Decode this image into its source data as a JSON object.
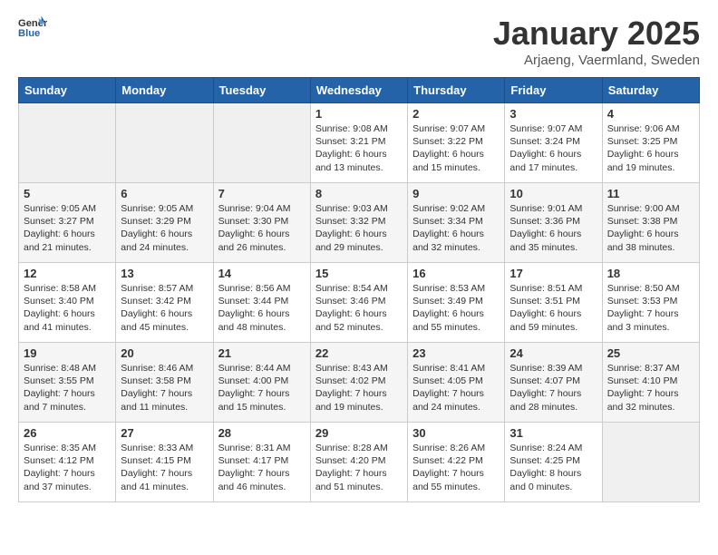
{
  "logo": {
    "text_general": "General",
    "text_blue": "Blue"
  },
  "title": "January 2025",
  "subtitle": "Arjaeng, Vaermland, Sweden",
  "headers": [
    "Sunday",
    "Monday",
    "Tuesday",
    "Wednesday",
    "Thursday",
    "Friday",
    "Saturday"
  ],
  "weeks": [
    [
      {
        "day": "",
        "sunrise": "",
        "sunset": "",
        "daylight": ""
      },
      {
        "day": "",
        "sunrise": "",
        "sunset": "",
        "daylight": ""
      },
      {
        "day": "",
        "sunrise": "",
        "sunset": "",
        "daylight": ""
      },
      {
        "day": "1",
        "sunrise": "Sunrise: 9:08 AM",
        "sunset": "Sunset: 3:21 PM",
        "daylight": "Daylight: 6 hours and 13 minutes."
      },
      {
        "day": "2",
        "sunrise": "Sunrise: 9:07 AM",
        "sunset": "Sunset: 3:22 PM",
        "daylight": "Daylight: 6 hours and 15 minutes."
      },
      {
        "day": "3",
        "sunrise": "Sunrise: 9:07 AM",
        "sunset": "Sunset: 3:24 PM",
        "daylight": "Daylight: 6 hours and 17 minutes."
      },
      {
        "day": "4",
        "sunrise": "Sunrise: 9:06 AM",
        "sunset": "Sunset: 3:25 PM",
        "daylight": "Daylight: 6 hours and 19 minutes."
      }
    ],
    [
      {
        "day": "5",
        "sunrise": "Sunrise: 9:05 AM",
        "sunset": "Sunset: 3:27 PM",
        "daylight": "Daylight: 6 hours and 21 minutes."
      },
      {
        "day": "6",
        "sunrise": "Sunrise: 9:05 AM",
        "sunset": "Sunset: 3:29 PM",
        "daylight": "Daylight: 6 hours and 24 minutes."
      },
      {
        "day": "7",
        "sunrise": "Sunrise: 9:04 AM",
        "sunset": "Sunset: 3:30 PM",
        "daylight": "Daylight: 6 hours and 26 minutes."
      },
      {
        "day": "8",
        "sunrise": "Sunrise: 9:03 AM",
        "sunset": "Sunset: 3:32 PM",
        "daylight": "Daylight: 6 hours and 29 minutes."
      },
      {
        "day": "9",
        "sunrise": "Sunrise: 9:02 AM",
        "sunset": "Sunset: 3:34 PM",
        "daylight": "Daylight: 6 hours and 32 minutes."
      },
      {
        "day": "10",
        "sunrise": "Sunrise: 9:01 AM",
        "sunset": "Sunset: 3:36 PM",
        "daylight": "Daylight: 6 hours and 35 minutes."
      },
      {
        "day": "11",
        "sunrise": "Sunrise: 9:00 AM",
        "sunset": "Sunset: 3:38 PM",
        "daylight": "Daylight: 6 hours and 38 minutes."
      }
    ],
    [
      {
        "day": "12",
        "sunrise": "Sunrise: 8:58 AM",
        "sunset": "Sunset: 3:40 PM",
        "daylight": "Daylight: 6 hours and 41 minutes."
      },
      {
        "day": "13",
        "sunrise": "Sunrise: 8:57 AM",
        "sunset": "Sunset: 3:42 PM",
        "daylight": "Daylight: 6 hours and 45 minutes."
      },
      {
        "day": "14",
        "sunrise": "Sunrise: 8:56 AM",
        "sunset": "Sunset: 3:44 PM",
        "daylight": "Daylight: 6 hours and 48 minutes."
      },
      {
        "day": "15",
        "sunrise": "Sunrise: 8:54 AM",
        "sunset": "Sunset: 3:46 PM",
        "daylight": "Daylight: 6 hours and 52 minutes."
      },
      {
        "day": "16",
        "sunrise": "Sunrise: 8:53 AM",
        "sunset": "Sunset: 3:49 PM",
        "daylight": "Daylight: 6 hours and 55 minutes."
      },
      {
        "day": "17",
        "sunrise": "Sunrise: 8:51 AM",
        "sunset": "Sunset: 3:51 PM",
        "daylight": "Daylight: 6 hours and 59 minutes."
      },
      {
        "day": "18",
        "sunrise": "Sunrise: 8:50 AM",
        "sunset": "Sunset: 3:53 PM",
        "daylight": "Daylight: 7 hours and 3 minutes."
      }
    ],
    [
      {
        "day": "19",
        "sunrise": "Sunrise: 8:48 AM",
        "sunset": "Sunset: 3:55 PM",
        "daylight": "Daylight: 7 hours and 7 minutes."
      },
      {
        "day": "20",
        "sunrise": "Sunrise: 8:46 AM",
        "sunset": "Sunset: 3:58 PM",
        "daylight": "Daylight: 7 hours and 11 minutes."
      },
      {
        "day": "21",
        "sunrise": "Sunrise: 8:44 AM",
        "sunset": "Sunset: 4:00 PM",
        "daylight": "Daylight: 7 hours and 15 minutes."
      },
      {
        "day": "22",
        "sunrise": "Sunrise: 8:43 AM",
        "sunset": "Sunset: 4:02 PM",
        "daylight": "Daylight: 7 hours and 19 minutes."
      },
      {
        "day": "23",
        "sunrise": "Sunrise: 8:41 AM",
        "sunset": "Sunset: 4:05 PM",
        "daylight": "Daylight: 7 hours and 24 minutes."
      },
      {
        "day": "24",
        "sunrise": "Sunrise: 8:39 AM",
        "sunset": "Sunset: 4:07 PM",
        "daylight": "Daylight: 7 hours and 28 minutes."
      },
      {
        "day": "25",
        "sunrise": "Sunrise: 8:37 AM",
        "sunset": "Sunset: 4:10 PM",
        "daylight": "Daylight: 7 hours and 32 minutes."
      }
    ],
    [
      {
        "day": "26",
        "sunrise": "Sunrise: 8:35 AM",
        "sunset": "Sunset: 4:12 PM",
        "daylight": "Daylight: 7 hours and 37 minutes."
      },
      {
        "day": "27",
        "sunrise": "Sunrise: 8:33 AM",
        "sunset": "Sunset: 4:15 PM",
        "daylight": "Daylight: 7 hours and 41 minutes."
      },
      {
        "day": "28",
        "sunrise": "Sunrise: 8:31 AM",
        "sunset": "Sunset: 4:17 PM",
        "daylight": "Daylight: 7 hours and 46 minutes."
      },
      {
        "day": "29",
        "sunrise": "Sunrise: 8:28 AM",
        "sunset": "Sunset: 4:20 PM",
        "daylight": "Daylight: 7 hours and 51 minutes."
      },
      {
        "day": "30",
        "sunrise": "Sunrise: 8:26 AM",
        "sunset": "Sunset: 4:22 PM",
        "daylight": "Daylight: 7 hours and 55 minutes."
      },
      {
        "day": "31",
        "sunrise": "Sunrise: 8:24 AM",
        "sunset": "Sunset: 4:25 PM",
        "daylight": "Daylight: 8 hours and 0 minutes."
      },
      {
        "day": "",
        "sunrise": "",
        "sunset": "",
        "daylight": ""
      }
    ]
  ]
}
